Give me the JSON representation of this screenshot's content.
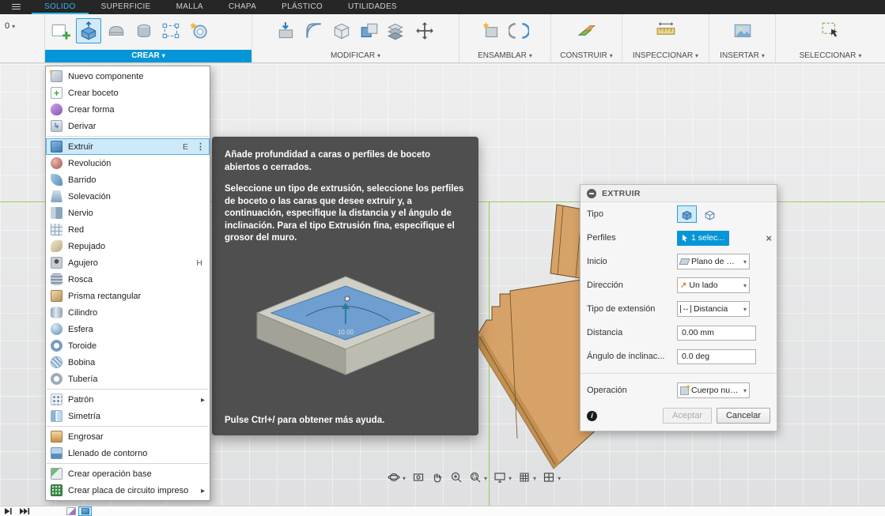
{
  "app": {
    "left_control": "0",
    "topbar": {
      "tabs": [
        {
          "label": "SOLIDO",
          "active": true
        },
        {
          "label": "SUPERFICIE"
        },
        {
          "label": "MALLA"
        },
        {
          "label": "CHAPA"
        },
        {
          "label": "PLÁSTICO"
        },
        {
          "label": "UTILIDADES"
        }
      ]
    },
    "ribbon": {
      "groups": [
        {
          "label": "CREAR",
          "active": true
        },
        {
          "label": "MODIFICAR"
        },
        {
          "label": "ENSAMBLAR"
        },
        {
          "label": "CONSTRUIR"
        },
        {
          "label": "INSPECCIONAR"
        },
        {
          "label": "INSERTAR"
        },
        {
          "label": "SELECCIONAR"
        }
      ]
    }
  },
  "create_menu": {
    "items": [
      {
        "label": "Nuevo componente"
      },
      {
        "label": "Crear boceto"
      },
      {
        "label": "Crear forma"
      },
      {
        "label": "Derivar"
      },
      {
        "label": "Extruir",
        "shortcut": "E",
        "highlighted": true
      },
      {
        "label": "Revolución"
      },
      {
        "label": "Barrido"
      },
      {
        "label": "Solevación"
      },
      {
        "label": "Nervio"
      },
      {
        "label": "Red"
      },
      {
        "label": "Repujado"
      },
      {
        "label": "Agujero",
        "shortcut": "H"
      },
      {
        "label": "Rosca"
      },
      {
        "label": "Prisma rectangular"
      },
      {
        "label": "Cilindro"
      },
      {
        "label": "Esfera"
      },
      {
        "label": "Toroide"
      },
      {
        "label": "Bobina"
      },
      {
        "label": "Tubería"
      },
      {
        "label": "Patrón",
        "submenu": true
      },
      {
        "label": "Simetría"
      },
      {
        "label": "Engrosar"
      },
      {
        "label": "Llenado de contorno"
      },
      {
        "label": "Crear operación base"
      },
      {
        "label": "Crear placa de circuito impreso",
        "submenu": true
      }
    ]
  },
  "tooltip": {
    "heading": "Añade profundidad a caras o perfiles de boceto abiertos o cerrados.",
    "body": "Seleccione un tipo de extrusión, seleccione los perfiles de boceto o las caras que desee extruir y, a continuación, especifique la distancia y el ángulo de inclinación. Para el tipo Extrusión fina, especifique el grosor del muro.",
    "dim_label": "10.00",
    "footer": "Pulse Ctrl+/ para obtener más ayuda."
  },
  "dialog": {
    "title": "EXTRUIR",
    "labels": {
      "tipo": "Tipo",
      "perfiles": "Perfiles",
      "inicio": "Inicio",
      "direccion": "Dirección",
      "extension": "Tipo de extensión",
      "distancia": "Distancia",
      "angulo": "Ángulo de inclinac...",
      "operacion": "Operación"
    },
    "values": {
      "perfiles": "1 selec...",
      "inicio": "Plano de pe...",
      "direccion": "Un lado",
      "extension": "Distancia",
      "distancia": "0.00 mm",
      "angulo": "0.0 deg",
      "operacion": "Cuerpo nue..."
    },
    "buttons": {
      "ok": "Aceptar",
      "cancel": "Cancelar"
    }
  },
  "colors": {
    "accent": "#0696d7",
    "active_tab": "#35b1e8",
    "axis_green": "#86c440",
    "wood": "#d6a267"
  }
}
